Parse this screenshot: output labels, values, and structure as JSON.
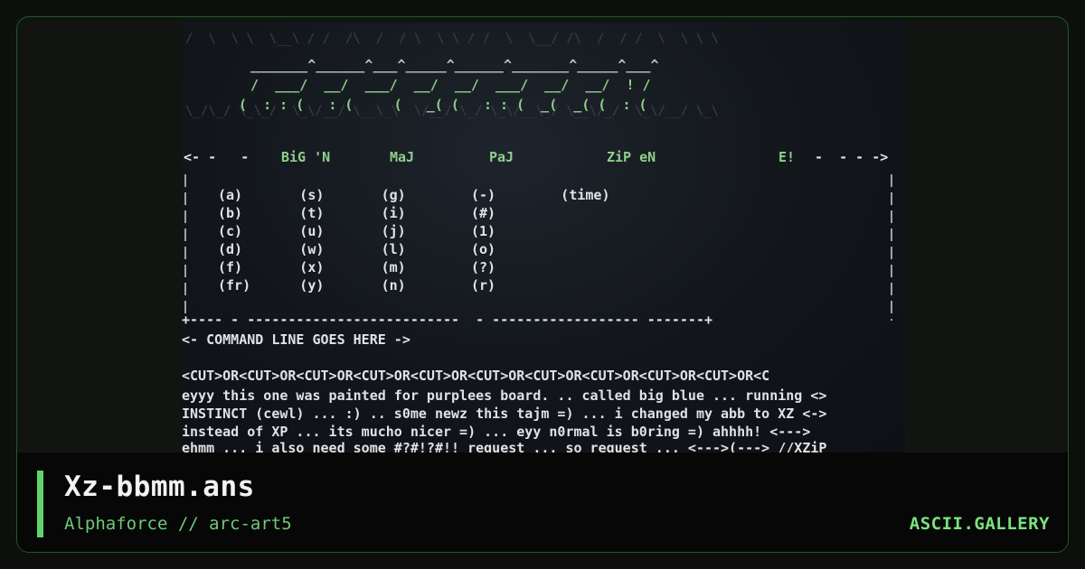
{
  "artwork": {
    "title": "Xz-bbmm.ans",
    "subtitle": "Alphaforce // arc-art5",
    "site": "ASCII.GALLERY"
  },
  "ansi_lines": {
    "logo_top": "_______^______^___^_____^______^_______^_____^___^",
    "logo_mid": "  /  ___/  __/  ___/  __/  __/  ___/  __/  __/  ! /",
    "logo_bot": " (  : : (   : (     (   _( (   : : (  _(  _( (  : (",
    "header_left": "<- -   -",
    "header_bigm": "BiG 'N",
    "header_majx": "MaJ",
    "header_paj": "PaJ",
    "header_zip": "ZiP eN",
    "header_e": "E!",
    "header_right": "-  - - ->",
    "menu_rows": [
      "(a)       (s)       (g)        (-)        (time)",
      "(b)       (t)       (i)        (#)",
      "(c)       (u)       (j)        (1)",
      "(d)       (w)       (l)        (o)",
      "(f)       (x)       (m)        (?)",
      "(fr)      (y)       (n)        (r)"
    ],
    "border_line": "+---- - --------------------------  - ------------------ -------+",
    "command": "<- COMMAND LINE GOES HERE ->",
    "cut_line": "<CUT>OR<CUT>OR<CUT>OR<CUT>OR<CUT>OR<CUT>OR<CUT>OR<CUT>OR<CUT>OR<CUT>OR<C",
    "text_lines": [
      "eyyy this one was painted for purplees board. .. called big blue ... running <>",
      "INSTINCT (cewl) ... :) .. s0me newz this tajm =) ... i changed my abb to XZ <->",
      "instead of XP ... its mucho nicer =) ... eyy n0rmal is b0ring =) ahhhh! <--->",
      "ehmm ,,. i also need some #?#!?#!! request ... so request ... <--->(---> //XZiP"
    ]
  }
}
